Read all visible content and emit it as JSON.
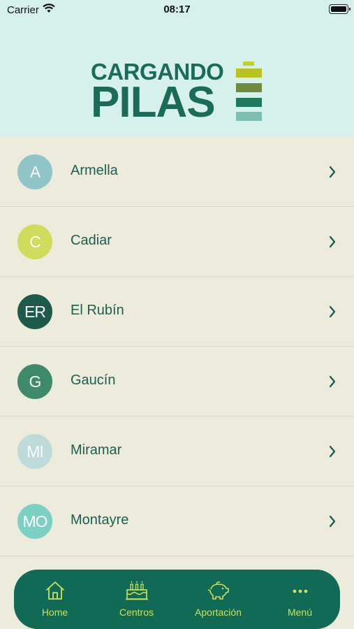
{
  "status": {
    "carrier": "Carrier",
    "time": "08:17"
  },
  "logo": {
    "line1": "CARGANDO",
    "line2": "PILAS"
  },
  "colors": {
    "header_bg": "#d6f0ec",
    "list_bg": "#ecebdc",
    "text": "#1a5f52",
    "tabbar_bg": "#106a55",
    "tab_text": "#cfe15a"
  },
  "centers": [
    {
      "initials": "A",
      "name": "Armella",
      "color": "#8fc4c9"
    },
    {
      "initials": "C",
      "name": "Cadiar",
      "color": "#cfdb5a"
    },
    {
      "initials": "ER",
      "name": "El Rubín",
      "color": "#1e5a4a"
    },
    {
      "initials": "G",
      "name": "Gaucín",
      "color": "#3e8a6c"
    },
    {
      "initials": "MI",
      "name": "Miramar",
      "color": "#bedbd9"
    },
    {
      "initials": "MO",
      "name": "Montayre",
      "color": "#7ccfc3"
    }
  ],
  "tabs": [
    {
      "label": "Home",
      "icon": "home-icon"
    },
    {
      "label": "Centros",
      "icon": "cake-icon"
    },
    {
      "label": "Aportación",
      "icon": "piggy-bank-icon"
    },
    {
      "label": "Menú",
      "icon": "more-icon"
    }
  ]
}
